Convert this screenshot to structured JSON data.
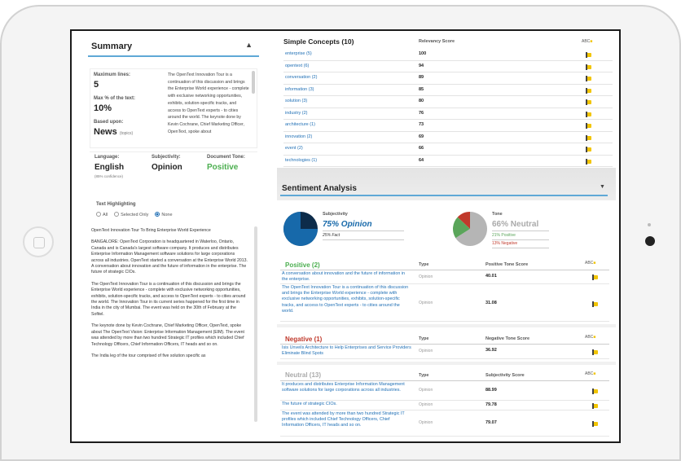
{
  "summary": {
    "title": "Summary",
    "max_lines_label": "Maximum lines:",
    "max_lines_value": "5",
    "max_pct_label": "Max % of the text:",
    "max_pct_value": "10%",
    "based_upon_label": "Based upon:",
    "based_upon_value": "News",
    "based_upon_sub": "(topics)",
    "text": "The OpenText Innovation Tour is a continuation of this discussion and brings the Enterprise World experience - complete with exclusive networking opportunities, exhibits, solution-specific tracks, and access to OpenText experts - to cities around the world. The keynote done by Kevin Cochrane, Chief Marketing Officer, OpenText, spoke about",
    "language_label": "Language:",
    "language_value": "English",
    "language_sub": "(85% confidence)",
    "subjectivity_label": "Subjectivity:",
    "subjectivity_value": "Opinion",
    "tone_label": "Document Tone:",
    "tone_value": "Positive",
    "tone_color": "#4caf50"
  },
  "highlighting": {
    "label": "Text Highlighting",
    "options": [
      "All",
      "Selected Only",
      "None"
    ],
    "selected": "None"
  },
  "article": {
    "paragraphs": [
      "OpenText Innovation Tour To Bring Enterprise World Experience",
      "BANGALORE: OpenText Corporation is headquartered in Waterloo, Ontario, Canada and is Canada's largest software company. It produces and distributes Enterprise Information Management software solutions for large corporations across all industries. OpenText started a conversation at the Enterprise World 2013. A conversation about innovation and the future of information in the enterprise. The future of strategic CIOs.",
      "The OpenText Innovation Tour is a continuation of this discussion and brings the Enterprise World experience - complete with exclusive networking opportunities, exhibits, solution-specific tracks, and access to OpenText experts - to cities around the world. The Innovation Tour in its current series happened for the first time in India in the city of Mumbai. The event was held on the 30th of February at the Sofitel.",
      "The keynote done by Kevin Cochrane, Chief Marketing Officer, OpenText, spoke about The OpenText Vision: Enterprise Information Management (EIM). The event was attended by more than two hundred Strategic IT profiles which included Chief Technology Officers, Chief Information Officers, IT heads and so on.",
      "The India leg of the tour comprised of five solution specific as"
    ]
  },
  "simple_concepts": {
    "title": "Simple Concepts (10)",
    "score_header": "Relevancy Score",
    "rows": [
      {
        "term": "enterprise (5)",
        "score": "100"
      },
      {
        "term": "opentext (6)",
        "score": "94"
      },
      {
        "term": "conversation (2)",
        "score": "89"
      },
      {
        "term": "information (3)",
        "score": "85"
      },
      {
        "term": "solution (3)",
        "score": "80"
      },
      {
        "term": "industry (2)",
        "score": "76"
      },
      {
        "term": "architecture (1)",
        "score": "73"
      },
      {
        "term": "innovation (2)",
        "score": "69"
      },
      {
        "term": "event (2)",
        "score": "66"
      },
      {
        "term": "technologies (1)",
        "score": "64"
      }
    ]
  },
  "sentiment": {
    "title": "Sentiment Analysis",
    "subjectivity_label": "Subjectivity",
    "subjectivity_value": "75% Opinion",
    "subjectivity_sub": "25% Fact",
    "subjectivity_opinion_fraction": 0.75,
    "tone_label": "Tone",
    "tone_value": "66% Neutral",
    "tone_positive": "21% Positive",
    "tone_negative": "13% Negative",
    "tone_fractions": {
      "neutral": 0.66,
      "positive": 0.21,
      "negative": 0.13
    },
    "colors": {
      "opinion": "#1769aa",
      "fact": "#0d2c4a",
      "neutral": "#b5b5b5",
      "positive": "#5aa55a",
      "negative": "#c0392b"
    },
    "type_header": "Type",
    "positive": {
      "title": "Positive (2)",
      "score_header": "Positive Tone Score",
      "rows": [
        {
          "text": "A conversation about innovation and the future of information in the enterprise.",
          "type": "Opinion",
          "score": "40.01"
        },
        {
          "text": "The OpenText Innovation Tour is a continuation of this discussion and brings the Enterprise World experience - complete with exclusive networking opportunities, exhibits, solution-specific tracks, and access to OpenText experts - to cities around the world.",
          "type": "Opinion",
          "score": "31.08"
        }
      ]
    },
    "negative": {
      "title": "Negative (1)",
      "score_header": "Negative Tone Score",
      "rows": [
        {
          "text": "Isis Unveils Architecture to Help Enterprises and Service Providers Eliminate Blind Spots",
          "type": "Opinion",
          "score": "36.92"
        }
      ]
    },
    "neutral": {
      "title": "Neutral (13)",
      "score_header": "Subjectivity Score",
      "rows": [
        {
          "text": "It produces and distributes Enterprise Information Management software solutions for large corporations across all industries.",
          "type": "Opinion",
          "score": "88.99"
        },
        {
          "text": "The future of strategic CIOs.",
          "type": "Opinion",
          "score": "79.78"
        },
        {
          "text": "The event was attended by more than two hundred Strategic IT profiles which included Chief Technology Officers, Chief Information Officers, IT heads and so on.",
          "type": "Opinion",
          "score": "79.07"
        }
      ]
    }
  },
  "header_icon": {
    "label": "ABC"
  }
}
